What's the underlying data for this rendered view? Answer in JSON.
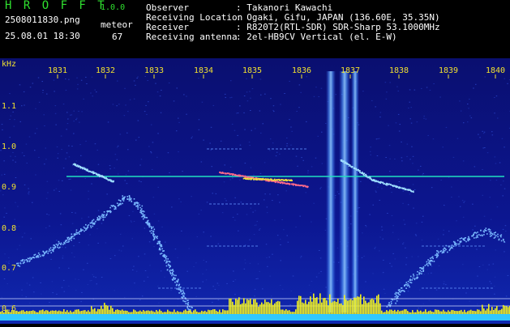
{
  "header": {
    "app_title": "H R O F F T",
    "app_version": "1.0.0",
    "filename": "2508011830.png",
    "datetime": "25.08.01 18:30",
    "detection_type": "meteor",
    "detection_count": "67",
    "info": [
      {
        "label": "Observer",
        "value": ": Takanori Kawachi"
      },
      {
        "label": "Receiving Location",
        "value": ": Ogaki, Gifu, JAPAN (136.60E, 35.35N)"
      },
      {
        "label": "Receiver",
        "value": ": R820T2(RTL-SDR) SDR-Sharp 53.1000MHz"
      },
      {
        "label": "Receiving antenna",
        "value": ": 2el-HB9CV Vertical (el. E-W)"
      }
    ]
  },
  "axes": {
    "y_unit": "kHz",
    "x_ticks": [
      "1831",
      "1832",
      "1833",
      "1834",
      "1835",
      "1836",
      "1837",
      "1838",
      "1839",
      "1840"
    ],
    "y_ticks": [
      "1.1",
      "1.0",
      "0.9",
      "0.8",
      "0.7",
      "0.6"
    ]
  },
  "colors": {
    "background": "#0a0f6e",
    "header_title": "#2fe02f",
    "axis_text": "#f0e030",
    "carrier": "#20e0c0",
    "signal_bars": "#f0f020",
    "baseline": "#30c8ff"
  }
}
